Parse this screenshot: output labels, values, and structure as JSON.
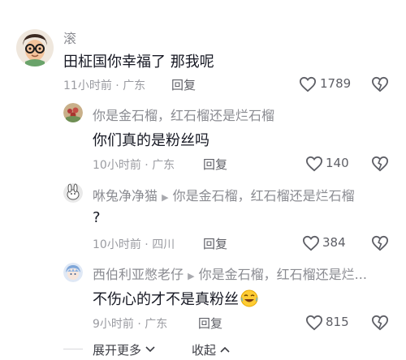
{
  "comments": [
    {
      "author": "滚",
      "text": "田柾国你幸福了 那我呢",
      "time": "11小时前",
      "location": "广东",
      "reply_label": "回复",
      "likes": "1789"
    },
    {
      "author": "你是金石榴，红石榴还是烂石榴",
      "text": "你们真的是粉丝吗",
      "time": "10小时前",
      "location": "广东",
      "reply_label": "回复",
      "likes": "140"
    },
    {
      "author": "咻兔净净猫",
      "reply_to": "你是金石榴，红石榴还是烂石榴",
      "text": "?",
      "time": "10小时前",
      "location": "四川",
      "reply_label": "回复",
      "likes": "384"
    },
    {
      "author": "西伯利亚憋老仔",
      "reply_to": "你是金石榴，红石榴还是烂...",
      "text": "不伤心的才不是真粉丝",
      "time": "9小时前",
      "location": "广东",
      "reply_label": "回复",
      "likes": "815"
    }
  ],
  "separator": "·",
  "footer": {
    "expand_label": "展开更多",
    "collapse_label": "收起"
  },
  "colors": {
    "text": "#161823",
    "secondary": "#8a8b91",
    "icon": "#5e5f66"
  }
}
